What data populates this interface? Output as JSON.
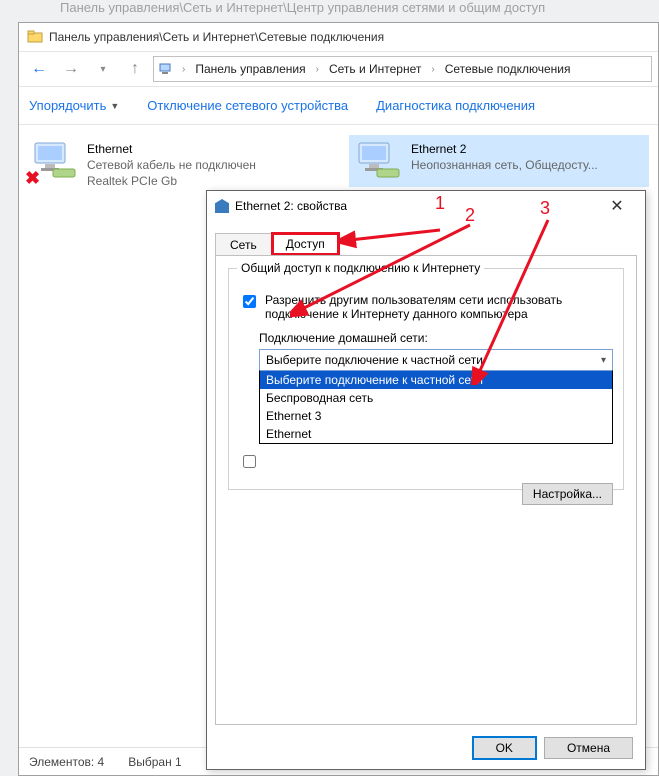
{
  "faded_title": "Панель управления\\Сеть и Интернет\\Центр управления сетями и общим доступ",
  "titlebar": "Панель управления\\Сеть и Интернет\\Сетевые подключения",
  "breadcrumbs": [
    "Панель управления",
    "Сеть и Интернет",
    "Сетевые подключения"
  ],
  "toolbar": {
    "organize": "Упорядочить",
    "disable": "Отключение сетевого устройства",
    "diagnose": "Диагностика подключения"
  },
  "connections": [
    {
      "name": "Ethernet",
      "status": "Сетевой кабель не подключен",
      "adapter": "Realtek PCIe Gb",
      "disconnected": true
    },
    {
      "name": "Ethernet 2",
      "status": "Неопознанная сеть, Общедосту...",
      "adapter": "",
      "disconnected": false
    }
  ],
  "statusbar": {
    "count": "Элементов: 4",
    "selected": "Выбран 1"
  },
  "dialog": {
    "title": "Ethernet 2: свойства",
    "tabs": {
      "network": "Сеть",
      "sharing": "Доступ"
    },
    "group_title": "Общий доступ к подключению к Интернету",
    "checkbox1": "Разрешить другим пользователям сети использовать подключение к Интернету данного компьютера",
    "home_label": "Подключение домашней сети:",
    "combo_selected": "Выберите подключение к частной сети",
    "combo_options": [
      "Выберите подключение к частной сети",
      "Беспроводная сеть",
      "Ethernet 3",
      "Ethernet"
    ],
    "settings_btn": "Настройка...",
    "ok": "OK",
    "cancel": "Отмена"
  },
  "annotations": {
    "n1": "1",
    "n2": "2",
    "n3": "3"
  }
}
